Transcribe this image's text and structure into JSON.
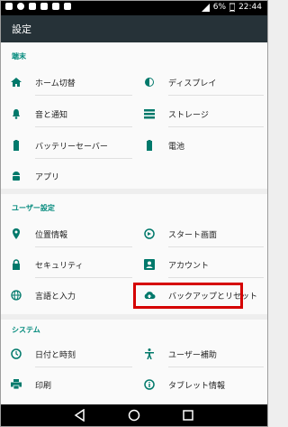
{
  "status_bar": {
    "battery": "6%",
    "time": "22:44"
  },
  "app_bar": {
    "title": "設定"
  },
  "sections": {
    "device": {
      "title": "端末",
      "items": {
        "home": "ホーム切替",
        "display": "ディスプレイ",
        "sound": "音と通知",
        "storage": "ストレージ",
        "battery_saver": "バッテリーセーバー",
        "battery": "電池",
        "apps": "アプリ"
      }
    },
    "user": {
      "title": "ユーザー設定",
      "items": {
        "location": "位置情報",
        "start_screen": "スタート画面",
        "security": "セキュリティ",
        "accounts": "アカウント",
        "language": "言語と入力",
        "backup": "バックアップとリセット"
      }
    },
    "system": {
      "title": "システム",
      "items": {
        "datetime": "日付と時刻",
        "accessibility": "ユーザー補助",
        "print": "印刷",
        "tablet_info": "タブレット情報"
      }
    }
  },
  "colors": {
    "accent": "#00897b",
    "app_bar": "#263238",
    "icon": "#00796b",
    "highlight": "#d50000"
  }
}
